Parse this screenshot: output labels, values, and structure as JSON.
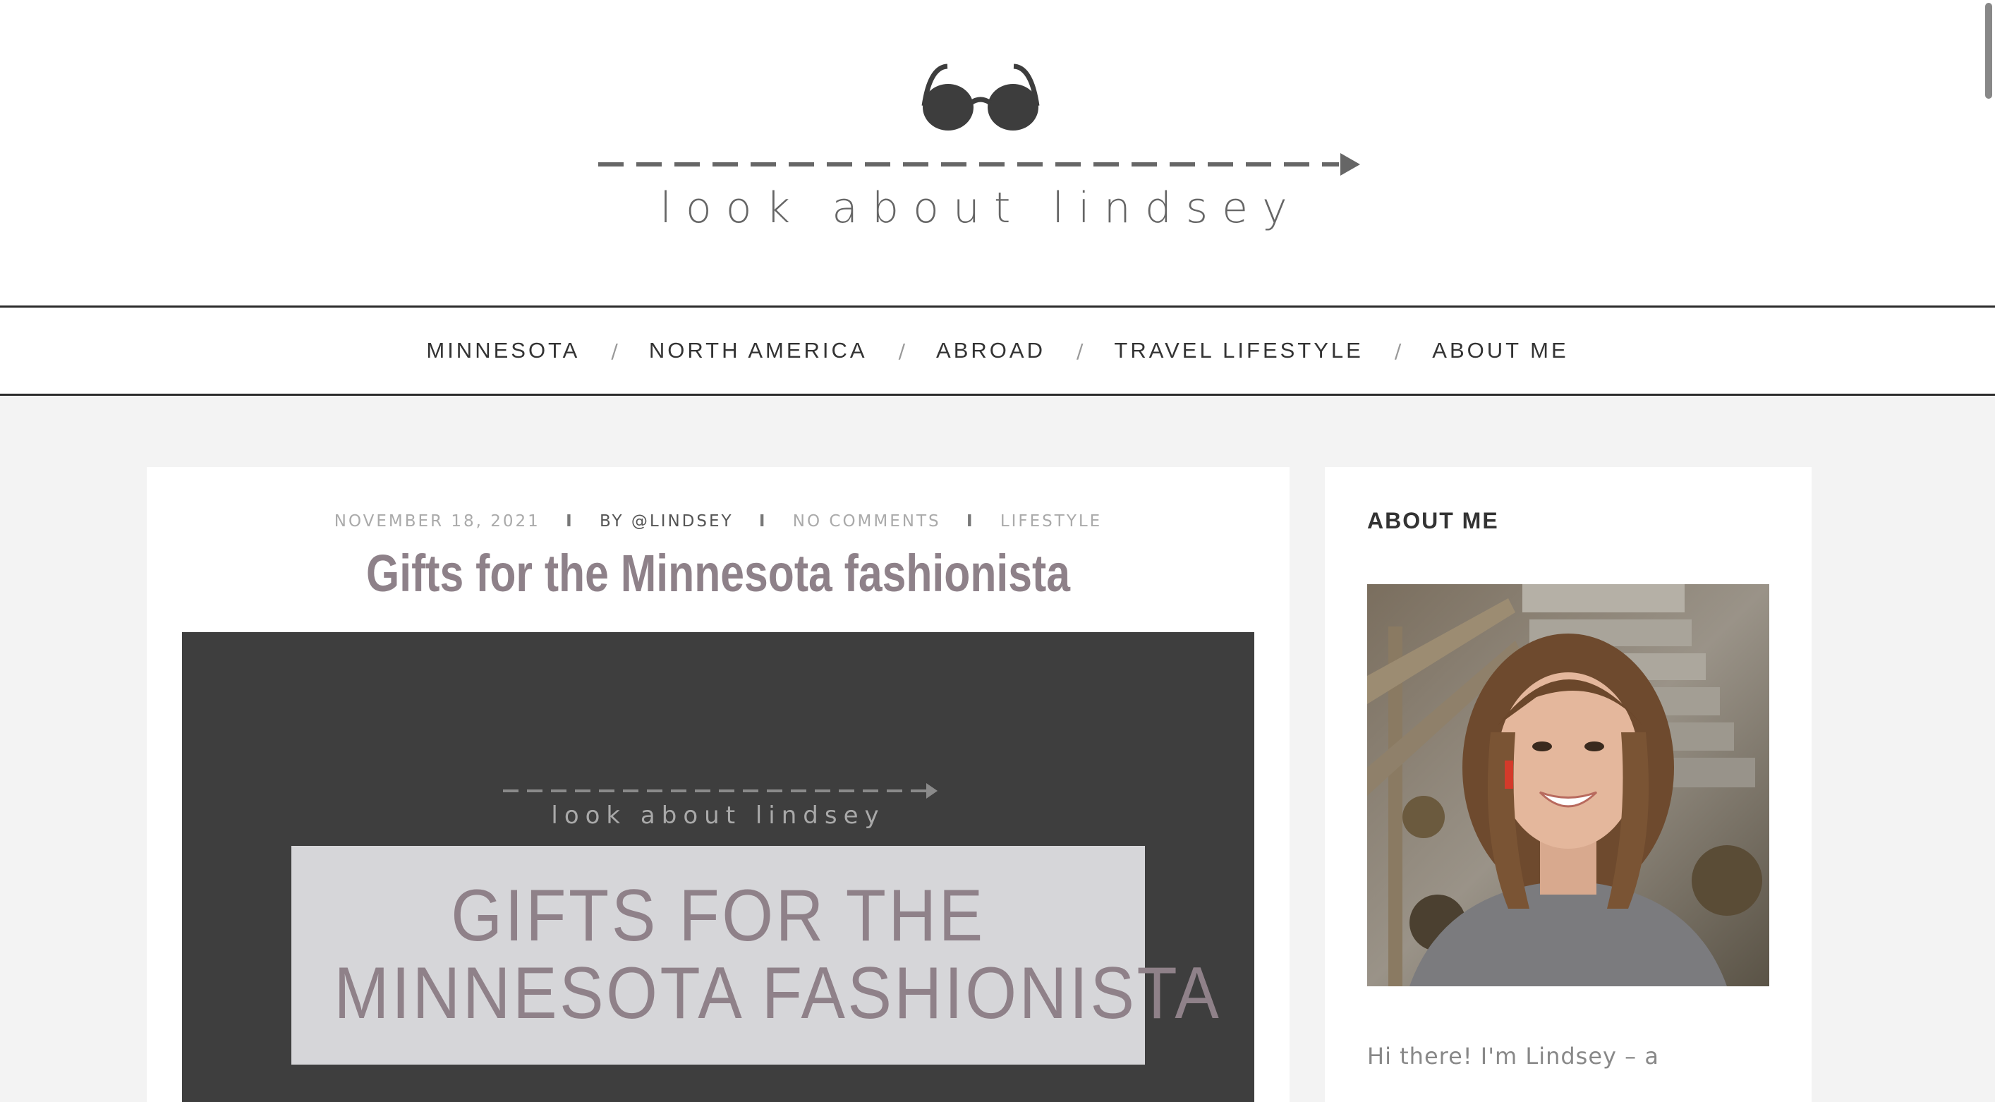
{
  "site": {
    "logo_text": "look about lindsey"
  },
  "nav": {
    "items": [
      {
        "label": "MINNESOTA"
      },
      {
        "label": "NORTH AMERICA"
      },
      {
        "label": "ABROAD"
      },
      {
        "label": "TRAVEL LIFESTYLE"
      },
      {
        "label": "ABOUT ME"
      }
    ],
    "separator": "/"
  },
  "post": {
    "date": "NOVEMBER 18, 2021",
    "author": "BY @LINDSEY",
    "comments": "NO COMMENTS",
    "category": "LIFESTYLE",
    "meta_separator": "I",
    "title": "Gifts for the Minnesota fashionista",
    "featured_image": {
      "logo_text": "look about lindsey",
      "line1": "GIFTS FOR THE",
      "line2": "MINNESOTA FASHIONISTA"
    }
  },
  "sidebar": {
    "widget_title": "ABOUT ME",
    "intro_text": "Hi there! I'm Lindsey – a"
  },
  "colors": {
    "accent": "#8e8189",
    "nav_border": "#2b2b2b",
    "background": "#f3f3f3",
    "image_bg": "#3e3e3e"
  },
  "icons": [
    "sunglasses-icon",
    "dashed-arrow-icon"
  ]
}
